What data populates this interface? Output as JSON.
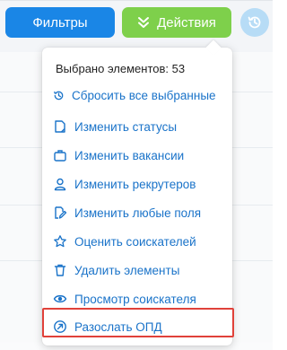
{
  "toolbar": {
    "filters_label": "Фильтры",
    "actions_label": "Действия",
    "history_icon": "history-icon"
  },
  "menu": {
    "selected_count": "Выбрано элементов: 53",
    "reset_label": "Сбросить все выбранные",
    "items": [
      {
        "label": "Изменить статусы",
        "icon": "document-icon"
      },
      {
        "label": "Изменить вакансии",
        "icon": "briefcase-icon"
      },
      {
        "label": "Изменить рекрутеров",
        "icon": "user-icon"
      },
      {
        "label": "Изменить любые поля",
        "icon": "edit-fields-icon"
      },
      {
        "label": "Оценить соискателей",
        "icon": "star-icon"
      },
      {
        "label": "Удалить элементы",
        "icon": "trash-icon"
      },
      {
        "label": "Просмотр соискателя",
        "icon": "eye-icon"
      },
      {
        "label": "Разослать ОПД",
        "icon": "send-icon"
      }
    ]
  },
  "colors": {
    "filters_button": "#1a86e6",
    "actions_button": "#7ed04b",
    "menu_link": "#1a73c9",
    "highlight": "#e0413a"
  }
}
